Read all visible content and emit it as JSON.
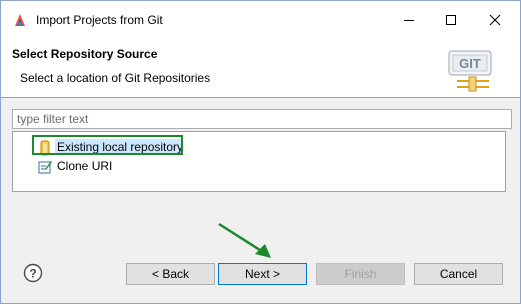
{
  "window": {
    "title": "Import Projects from Git",
    "icon": "eclipse-git-icon"
  },
  "header": {
    "title": "Select Repository Source",
    "description": "Select a location of Git Repositories",
    "banner_text": "GIT"
  },
  "filter": {
    "placeholder": "type filter text",
    "value": ""
  },
  "tree": {
    "items": [
      {
        "label": "Existing local repository",
        "icon": "repository-icon",
        "selected": true,
        "highlighted": true
      },
      {
        "label": "Clone URI",
        "icon": "clone-uri-icon",
        "selected": false,
        "highlighted": false
      }
    ]
  },
  "buttons": {
    "back": "< Back",
    "next": "Next >",
    "finish": "Finish",
    "cancel": "Cancel"
  },
  "colors": {
    "highlight_border": "#1a8a2c",
    "selection_bg": "#cce8ff",
    "focus_border": "#0078d7",
    "annotation_arrow": "#1a8a2c"
  }
}
